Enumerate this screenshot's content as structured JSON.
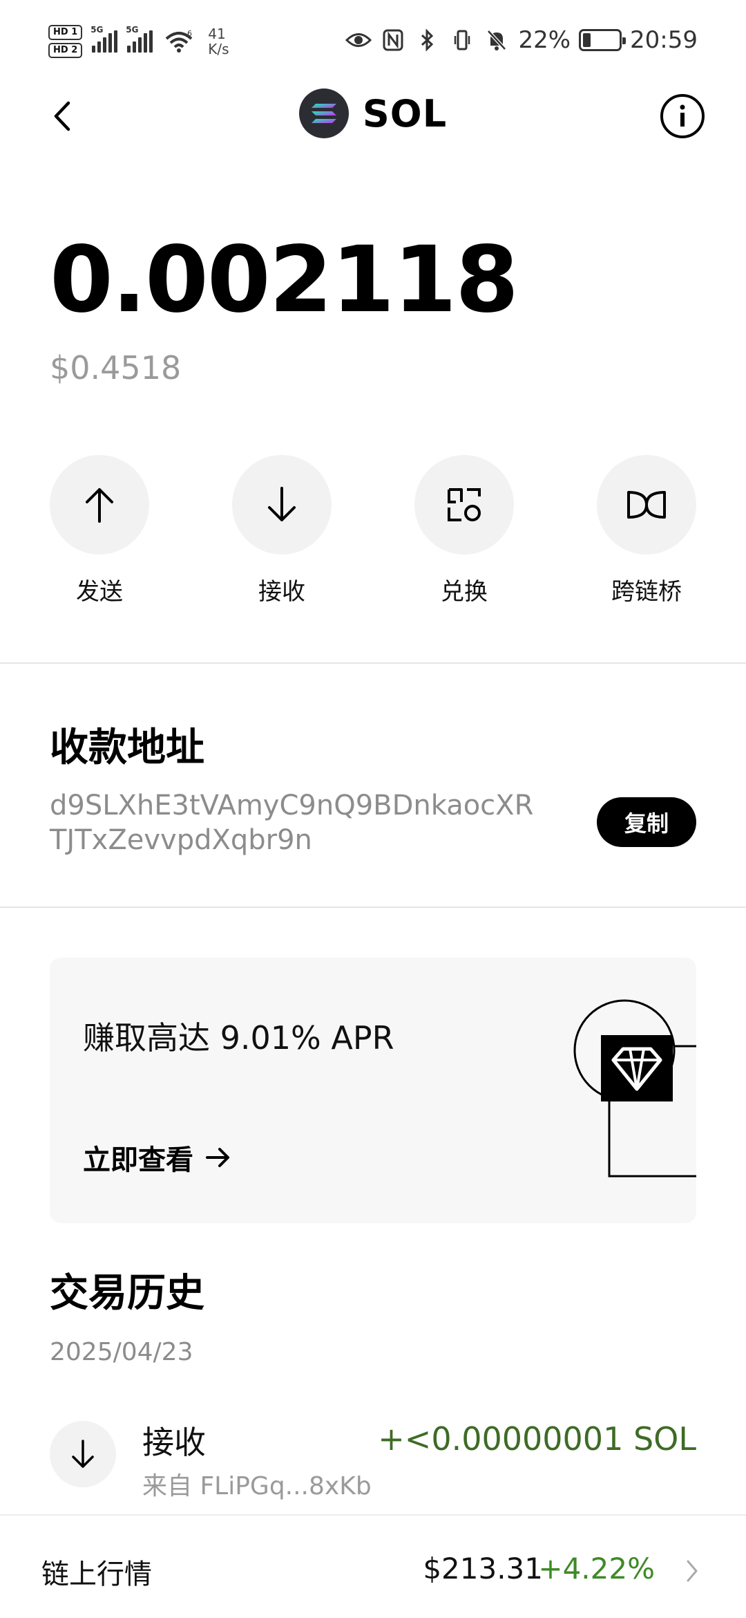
{
  "status_bar": {
    "hd1": "HD 1",
    "hd2": "HD 2",
    "sig1": "5G",
    "sig2": "5G",
    "wifi_tag": "6",
    "speed_value": "41",
    "speed_unit": "K/s",
    "battery_percent": "22%",
    "battery_level": 0.22,
    "time": "20:59",
    "icons": [
      "eye-icon",
      "nfc-icon",
      "bluetooth-icon",
      "vibrate-icon",
      "mute-bell-icon"
    ]
  },
  "header": {
    "title": "SOL"
  },
  "balance": {
    "amount": "0.002118",
    "usd": "$0.4518"
  },
  "actions": [
    {
      "label": "发送",
      "icon": "arrow-up-icon"
    },
    {
      "label": "接收",
      "icon": "arrow-down-icon"
    },
    {
      "label": "兑换",
      "icon": "swap-icon"
    },
    {
      "label": "跨链桥",
      "icon": "bridge-icon"
    }
  ],
  "address": {
    "title": "收款地址",
    "value": "d9SLXhE3tVAmyC9nQ9BDnkaocXRTJTxZevvpdXqbr9n",
    "copy_label": "复制"
  },
  "promo": {
    "text": "赚取高达 9.01% APR",
    "link": "立即查看"
  },
  "history": {
    "title": "交易历史",
    "date": "2025/04/23",
    "items": [
      {
        "type": "接收",
        "from": "来自 FLiPGq...8xKb",
        "amount": "+<0.00000001 SOL"
      }
    ]
  },
  "market": {
    "label": "链上行情",
    "price": "$213.31",
    "change": "+4.22%"
  },
  "colors": {
    "positive": "#3e6b26",
    "muted": "#8c8c8c",
    "circle_bg": "#f2f2f2"
  }
}
